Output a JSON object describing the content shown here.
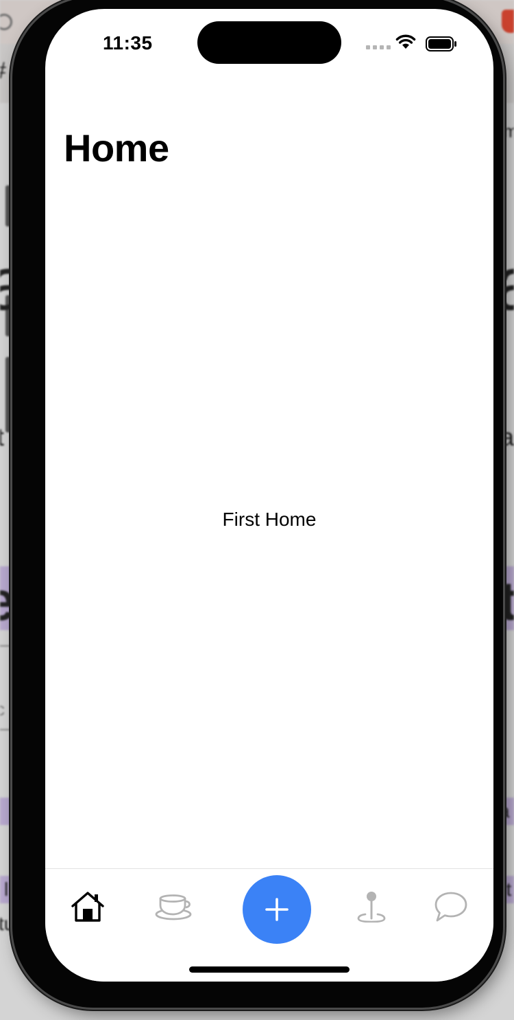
{
  "status_bar": {
    "time": "11:35"
  },
  "header": {
    "title": "Home"
  },
  "main": {
    "content_text": "First Home"
  },
  "tab_bar": {
    "items": [
      {
        "name": "home",
        "icon": "home-icon",
        "active": true
      },
      {
        "name": "cup",
        "icon": "coffee-cup-icon",
        "active": false
      },
      {
        "name": "add",
        "icon": "plus-icon",
        "active": false
      },
      {
        "name": "location",
        "icon": "map-pin-icon",
        "active": false
      },
      {
        "name": "chat",
        "icon": "chat-bubble-icon",
        "active": false
      }
    ],
    "active_color": "#000000",
    "inactive_color": "#b3b3b3",
    "fab_color": "#3b82f6"
  },
  "background_fragments": {
    "left": [
      "#",
      "a",
      "t",
      "e",
      "c",
      "l",
      "tu"
    ],
    "right": [
      "m",
      "a",
      "ar",
      "t",
      "a",
      "lit"
    ]
  }
}
